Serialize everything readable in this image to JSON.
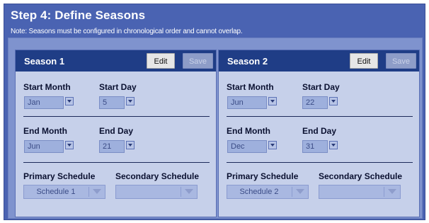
{
  "page": {
    "title": "Step 4: Define Seasons",
    "note": "Note: Seasons must be configured in chronological order and cannot overlap."
  },
  "labels": {
    "start_month": "Start Month",
    "start_day": "Start Day",
    "end_month": "End Month",
    "end_day": "End Day",
    "primary_schedule": "Primary Schedule",
    "secondary_schedule": "Secondary Schedule",
    "edit": "Edit",
    "save": "Save"
  },
  "seasons": [
    {
      "title": "Season 1",
      "start_month": "Jan",
      "start_day": "5",
      "end_month": "Jun",
      "end_day": "21",
      "primary_schedule": "Schedule 1",
      "secondary_schedule": ""
    },
    {
      "title": "Season 2",
      "start_month": "Jun",
      "start_day": "22",
      "end_month": "Dec",
      "end_day": "31",
      "primary_schedule": "Schedule 2",
      "secondary_schedule": ""
    }
  ],
  "colors": {
    "frame": "#4a63b2",
    "season_header": "#1f3d86",
    "season_body": "#c6d0ea"
  }
}
